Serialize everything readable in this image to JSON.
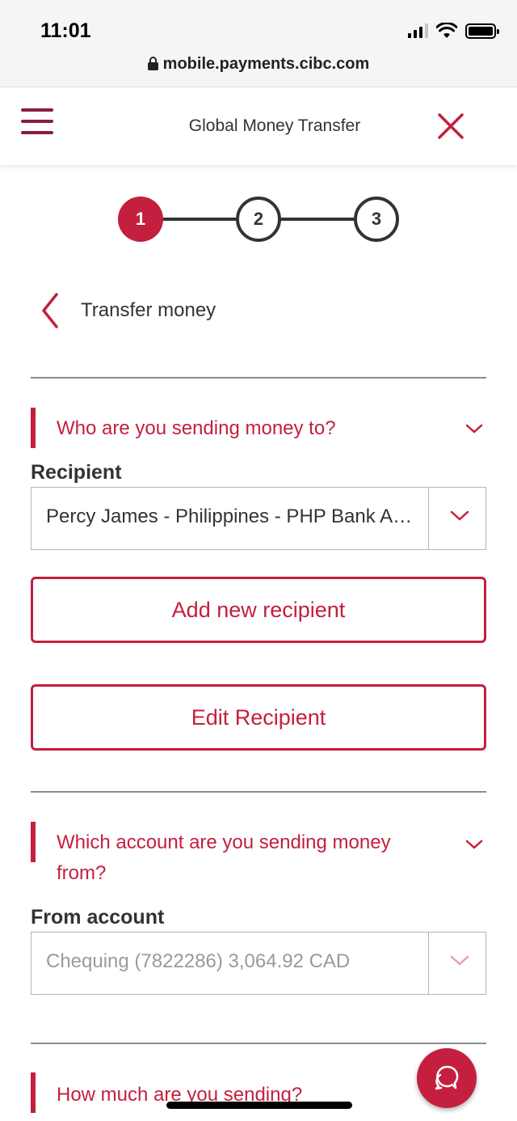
{
  "status_bar": {
    "time": "11:01",
    "url": "mobile.payments.cibc.com"
  },
  "app_bar": {
    "title": "Global Money Transfer"
  },
  "stepper": {
    "steps": [
      "1",
      "2",
      "3"
    ]
  },
  "back": {
    "label": "Transfer money"
  },
  "section_recipient": {
    "heading": "Who are you sending money to?",
    "field_label": "Recipient",
    "selected_value": "Percy James - Philippines - PHP Bank Ac...",
    "add_button": "Add new recipient",
    "edit_button": "Edit Recipient"
  },
  "section_account": {
    "heading_line1": "Which account are you sending money",
    "heading_line2": "from?",
    "field_label": "From account",
    "selected_value": "Chequing (7822286) 3,064.92 CAD"
  },
  "section_amount": {
    "heading": "How much are you sending?"
  },
  "colors": {
    "accent": "#c41f3e",
    "brand_dark": "#8b1d3c"
  }
}
